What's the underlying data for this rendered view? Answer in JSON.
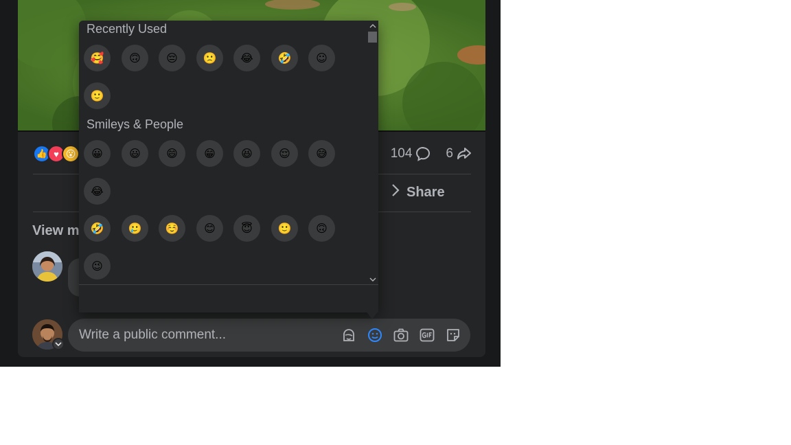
{
  "post": {
    "reaction_types": [
      "like",
      "love",
      "wow"
    ],
    "comment_count": "104",
    "share_count": "6",
    "share_label": "Share",
    "view_more_partial": "View m"
  },
  "composer": {
    "placeholder": "Write a public comment...",
    "icons": [
      "avatar-sticker-icon",
      "emoji-icon",
      "camera-icon",
      "gif-icon",
      "sticker-icon"
    ]
  },
  "emoji_picker": {
    "sections": [
      {
        "title": "Recently Used",
        "emojis": [
          "🥰",
          "🙃",
          "😔",
          "🙁",
          "😂",
          "🤣",
          "☺",
          "🙂"
        ]
      },
      {
        "title": "Smileys & People",
        "emojis": [
          "😀",
          "😃",
          "😄",
          "😁",
          "😆",
          "😌",
          "😅",
          "😂",
          "🤣",
          "🥲",
          "☺️",
          "😊",
          "😇",
          "🙂",
          "🙃",
          "😉"
        ]
      }
    ]
  },
  "colors": {
    "accent": "#2d88ff",
    "background": "#18191a",
    "card": "#242526",
    "input": "#3a3b3c",
    "text_secondary": "#b0b3b8"
  }
}
